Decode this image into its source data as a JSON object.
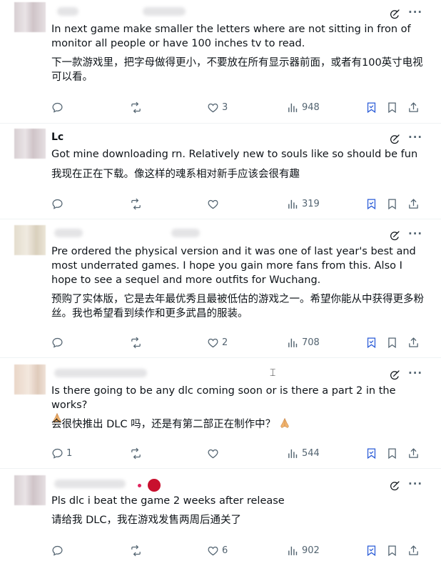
{
  "posts": [
    {
      "text": "In next game make smaller the letters where are not sitting in fron of monitor all people or have 100 inches tv to read.",
      "translation": "下一款游戏里，把字母做得更小，不要放在所有显示器前面，或者有100英寸电视可以看。",
      "replies": "",
      "reposts": "",
      "likes": "3",
      "views": "948"
    },
    {
      "name": "Lc",
      "text": "Got mine downloading rn. Relatively new to souls like so should be fun",
      "translation": "我现在正在下载。像这样的魂系相对新手应该会很有趣",
      "replies": "",
      "reposts": "",
      "likes": "",
      "views": "319"
    },
    {
      "text": "Pre ordered the physical version and it was one of last year's best and most underrated games. I hope you gain more fans from this. Also I hope to see a sequel and more outfits for Wuchang.",
      "translation": "预购了实体版，它是去年最优秀且最被低估的游戏之一。希望你能从中获得更多粉丝。我也希望看到续作和更多武昌的服装。",
      "replies": "",
      "reposts": "",
      "likes": "2",
      "views": "708"
    },
    {
      "text": "Is there going to be any dlc coming soon or is there a part 2 in the works?",
      "translation": "会很快推出 DLC 吗，还是有第二部正在制作中？",
      "replies": "1",
      "reposts": "",
      "likes": "",
      "views": "544"
    },
    {
      "text": "Pls dlc i beat the game 2 weeks after release",
      "translation": "请给我 DLC，我在游戏发售两周后通关了",
      "replies": "",
      "reposts": "",
      "likes": "6",
      "views": "902"
    }
  ],
  "icons": {
    "grok": "grok-icon",
    "more": "more-icon",
    "reply": "reply-icon",
    "repost": "repost-icon",
    "like": "heart-icon",
    "views": "views-icon",
    "grok_bookmark": "grok-analyze-icon",
    "bookmark": "bookmark-icon",
    "share": "share-icon"
  },
  "colors": {
    "icon_gray": "#536471",
    "text": "#0f1419",
    "accent": "#1d9bf0"
  },
  "more_label": "···"
}
